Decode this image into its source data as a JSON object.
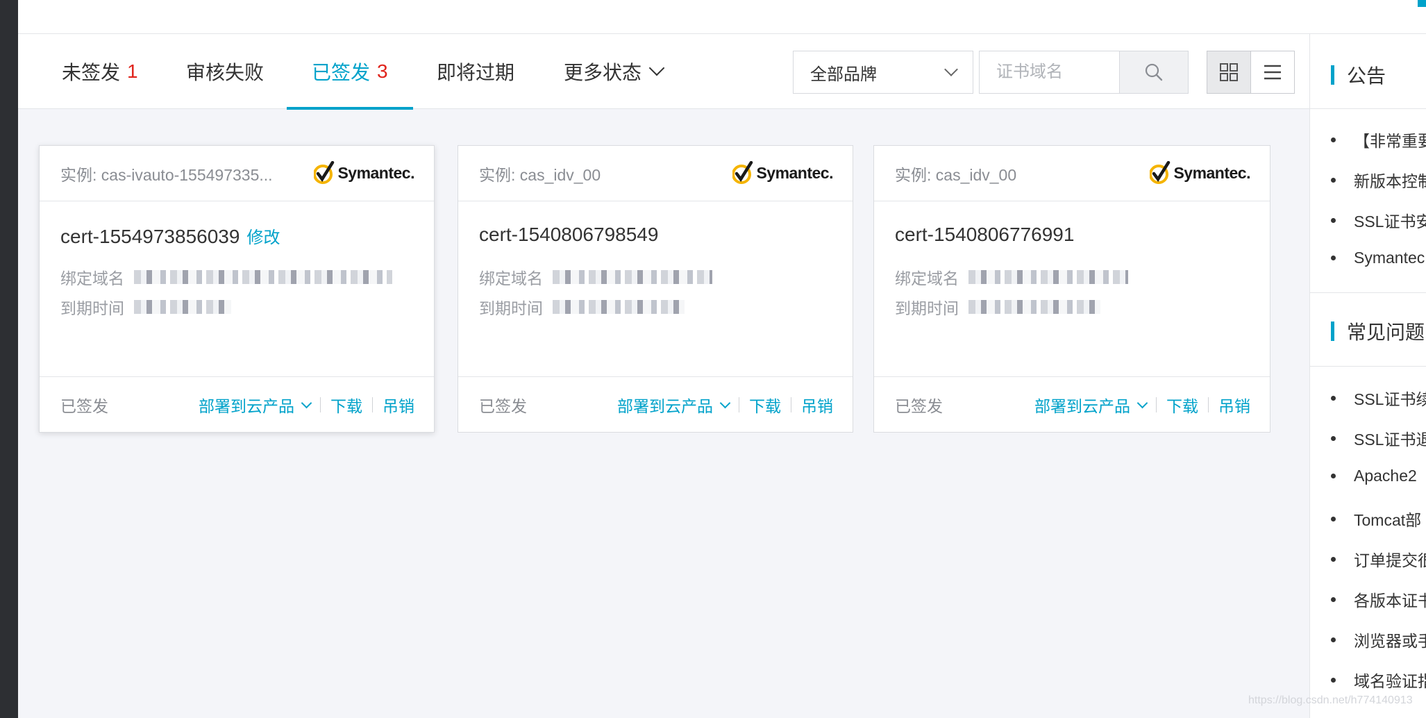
{
  "tabs": [
    {
      "label": "未签发",
      "count": "1"
    },
    {
      "label": "审核失败",
      "count": ""
    },
    {
      "label": "已签发",
      "count": "3"
    },
    {
      "label": "即将过期",
      "count": ""
    },
    {
      "label": "更多状态",
      "count": ""
    }
  ],
  "filters": {
    "brand_selected": "全部品牌",
    "search_placeholder": "证书域名"
  },
  "cards": [
    {
      "instance_prefix": "实例:",
      "instance": "cas-ivauto-155497335...",
      "brand": "Symantec.",
      "cert_name": "cert-1554973856039",
      "edit_label": "修改",
      "domain_label": "绑定域名",
      "expiry_label": "到期时间",
      "status": "已签发",
      "deploy_label": "部署到云产品",
      "download_label": "下载",
      "revoke_label": "吊销"
    },
    {
      "instance_prefix": "实例:",
      "instance": "cas_idv_00",
      "brand": "Symantec.",
      "cert_name": "cert-1540806798549",
      "edit_label": "",
      "domain_label": "绑定域名",
      "expiry_label": "到期时间",
      "status": "已签发",
      "deploy_label": "部署到云产品",
      "download_label": "下载",
      "revoke_label": "吊销"
    },
    {
      "instance_prefix": "实例:",
      "instance": "cas_idv_00",
      "brand": "Symantec.",
      "cert_name": "cert-1540806776991",
      "edit_label": "",
      "domain_label": "绑定域名",
      "expiry_label": "到期时间",
      "status": "已签发",
      "deploy_label": "部署到云产品",
      "download_label": "下载",
      "revoke_label": "吊销"
    }
  ],
  "panel": {
    "announce_title": "公告",
    "announcements": [
      "【非常重要",
      "新版本控制",
      "SSL证书安",
      "Symantec"
    ],
    "faq_title": "常见问题",
    "faqs": [
      "SSL证书续",
      "SSL证书退",
      "Apache2",
      "Tomcat部",
      "订单提交很",
      "各版本证书",
      "浏览器或手",
      "域名验证指"
    ]
  },
  "watermark": "https://blog.csdn.net/h774140913",
  "colors": {
    "accent": "#00a2ca",
    "count": "#e0241c",
    "symantec_check": "#f5b400"
  }
}
